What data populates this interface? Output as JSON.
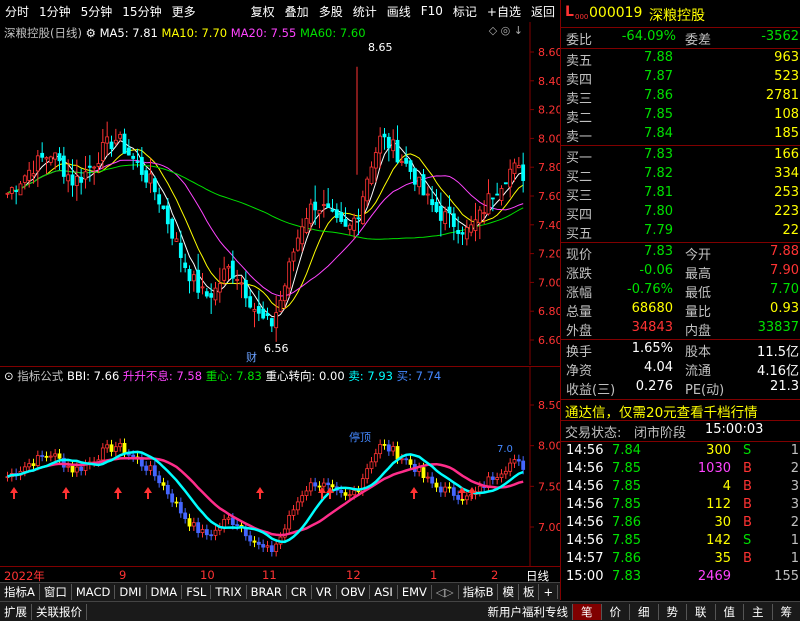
{
  "toolbar": {
    "left_items": [
      "分时",
      "1分钟",
      "5分钟",
      "15分钟",
      "更多"
    ],
    "right_items": [
      "复权",
      "叠加",
      "多股",
      "统计",
      "画线",
      "F10",
      "标记",
      "+自选",
      "返回"
    ]
  },
  "main_legend": {
    "title": "深粮控股(日线)",
    "ma5": "MA5: 7.81",
    "ma10": "MA10: 7.70",
    "ma20": "MA20: 7.55",
    "ma60": "MA60: 7.60"
  },
  "main_axis": [
    "8.60",
    "8.40",
    "8.20",
    "8.00",
    "7.80",
    "7.60",
    "7.40",
    "7.20",
    "7.00",
    "6.80",
    "6.60"
  ],
  "main_annotations": {
    "high": "8.65",
    "low": "6.56",
    "cai": "财"
  },
  "sub_legend": {
    "name": "指标公式",
    "bbi": "BBI: 7.66",
    "sheng": "升升不息: 7.58",
    "zhongxin": "重心: 7.83",
    "zhuanxiang": "重心转向: 0.00",
    "sell": "卖: 7.93",
    "buy": "买: 7.74"
  },
  "sub_axis": [
    "8.50",
    "8.00",
    "7.50",
    "7.00"
  ],
  "sub_annotations": {
    "tingjie": "停顶",
    "right_label": "7.0"
  },
  "x_axis": {
    "year": "2022年",
    "months": [
      "9",
      "10",
      "11",
      "12",
      "1",
      "2"
    ],
    "period": "日线"
  },
  "tabs": [
    "指标A",
    "窗口",
    "MACD",
    "DMI",
    "DMA",
    "FSL",
    "TRIX",
    "BRAR",
    "CR",
    "VR",
    "OBV",
    "ASI",
    "EMV",
    "指标B",
    "模",
    "板",
    "+",
    "-"
  ],
  "tabs2_left": [
    "扩展",
    "关联报价"
  ],
  "tabs2_right": [
    "新用户福利专线",
    "笔",
    "价",
    "细",
    "势",
    "联",
    "值",
    "主",
    "筹"
  ],
  "stock": {
    "prefix": "L",
    "code": "000019",
    "name": "深粮控股"
  },
  "weibi": {
    "label": "委比",
    "value": "-64.09%",
    "label2": "委差",
    "value2": "-3562"
  },
  "sells": [
    {
      "label": "卖五",
      "price": "7.88",
      "vol": "963"
    },
    {
      "label": "卖四",
      "price": "7.87",
      "vol": "523"
    },
    {
      "label": "卖三",
      "price": "7.86",
      "vol": "2781"
    },
    {
      "label": "卖二",
      "price": "7.85",
      "vol": "108"
    },
    {
      "label": "卖一",
      "price": "7.84",
      "vol": "185"
    }
  ],
  "buys": [
    {
      "label": "买一",
      "price": "7.83",
      "vol": "166"
    },
    {
      "label": "买二",
      "price": "7.82",
      "vol": "334"
    },
    {
      "label": "买三",
      "price": "7.81",
      "vol": "253"
    },
    {
      "label": "买四",
      "price": "7.80",
      "vol": "223"
    },
    {
      "label": "买五",
      "price": "7.79",
      "vol": "22"
    }
  ],
  "quote": [
    {
      "l1": "现价",
      "v1": "7.83",
      "c1": "green",
      "l2": "今开",
      "v2": "7.88",
      "c2": "red"
    },
    {
      "l1": "涨跌",
      "v1": "-0.06",
      "c1": "green",
      "l2": "最高",
      "v2": "7.90",
      "c2": "red"
    },
    {
      "l1": "涨幅",
      "v1": "-0.76%",
      "c1": "green",
      "l2": "最低",
      "v2": "7.70",
      "c2": "green"
    },
    {
      "l1": "总量",
      "v1": "68680",
      "c1": "yellow",
      "l2": "量比",
      "v2": "0.93",
      "c2": "yellow"
    },
    {
      "l1": "外盘",
      "v1": "34843",
      "c1": "red",
      "l2": "内盘",
      "v2": "33837",
      "c2": "green"
    }
  ],
  "quote2": [
    {
      "l1": "换手",
      "v1": "1.65%",
      "l2": "股本",
      "v2": "11.5亿"
    },
    {
      "l1": "净资",
      "v1": "4.04",
      "l2": "流通",
      "v2": "4.16亿"
    },
    {
      "l1": "收益(三)",
      "v1": "0.276",
      "l2": "PE(动)",
      "v2": "21.3"
    }
  ],
  "ad": "通达信，仅需20元查看千档行情",
  "status": {
    "label": "交易状态:",
    "phase": "闭市阶段",
    "time": "15:00:03"
  },
  "ticks": [
    {
      "t": "14:56",
      "p": "7.84",
      "v": "300",
      "bs": "S",
      "n": "1"
    },
    {
      "t": "14:56",
      "p": "7.85",
      "v": "1030",
      "bs": "B",
      "n": "2"
    },
    {
      "t": "14:56",
      "p": "7.85",
      "v": "4",
      "bs": "B",
      "n": "3"
    },
    {
      "t": "14:56",
      "p": "7.85",
      "v": "112",
      "bs": "B",
      "n": "3"
    },
    {
      "t": "14:56",
      "p": "7.86",
      "v": "30",
      "bs": "B",
      "n": "2"
    },
    {
      "t": "14:56",
      "p": "7.85",
      "v": "142",
      "bs": "S",
      "n": "1"
    },
    {
      "t": "14:57",
      "p": "7.86",
      "v": "35",
      "bs": "B",
      "n": "1"
    },
    {
      "t": "15:00",
      "p": "7.83",
      "v": "2469",
      "bs": "",
      "n": "155"
    }
  ],
  "colors": {
    "up": "#ff3333",
    "down": "#00ffff",
    "ma5": "#ffffff",
    "ma10": "#ffff00",
    "ma20": "#ff44ff",
    "ma60": "#00e000"
  }
}
